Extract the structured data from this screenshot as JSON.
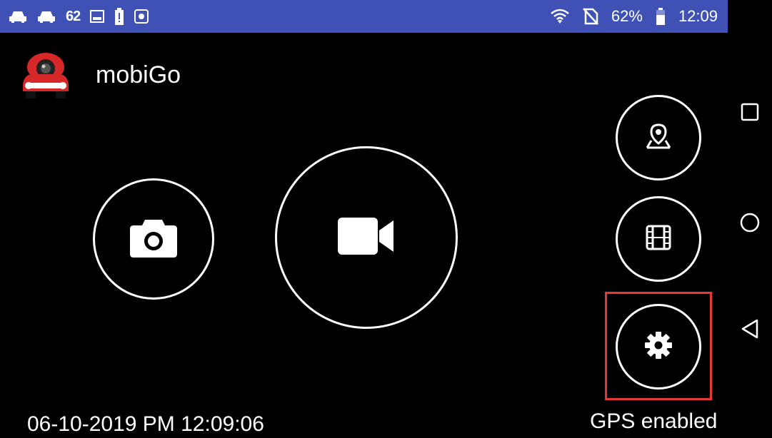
{
  "status_bar": {
    "left_icons": [
      "car-icon",
      "car-icon",
      "notification-62-icon",
      "image-icon",
      "battery-alert-icon",
      "app-notification-icon"
    ],
    "notification_count": "62",
    "battery_percent": "62%",
    "time": "12:09",
    "right_icons": [
      "wifi-icon",
      "no-sim-icon",
      "battery-icon"
    ]
  },
  "app": {
    "title": "mobiGo",
    "logo": "red-car-camera-logo"
  },
  "controls": {
    "photo": "camera-icon",
    "record": "video-camera-icon",
    "map": "map-pin-icon",
    "gallery": "film-icon",
    "settings": "gear-icon"
  },
  "footer": {
    "datetime": "06-10-2019 PM 12:09:06",
    "gps_status": "GPS enabled"
  },
  "nav_bar": {
    "buttons": [
      "recents-square-icon",
      "home-circle-icon",
      "back-triangle-icon"
    ]
  },
  "colors": {
    "status_bar": "#3f51b5",
    "background": "#000000",
    "highlight": "#e53935",
    "logo": "#d62828"
  }
}
